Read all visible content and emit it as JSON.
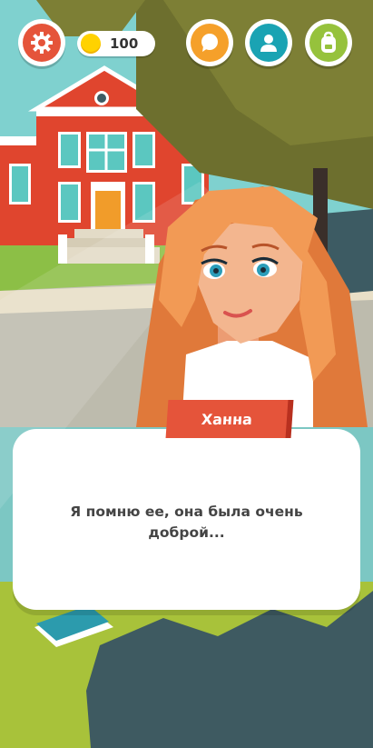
{
  "hud": {
    "coins": "100",
    "settings_icon": "gear-icon",
    "chat_icon": "speech-bubble-icon",
    "profile_icon": "person-icon",
    "inventory_icon": "backpack-icon"
  },
  "dialog": {
    "speaker": "Ханна",
    "text": "Я помню ее, она была очень доброй..."
  },
  "colors": {
    "settings": "#e5543a",
    "chat": "#f5a02a",
    "profile": "#1aa3b3",
    "inventory": "#96c23c",
    "name_tag": "#e5543a"
  }
}
